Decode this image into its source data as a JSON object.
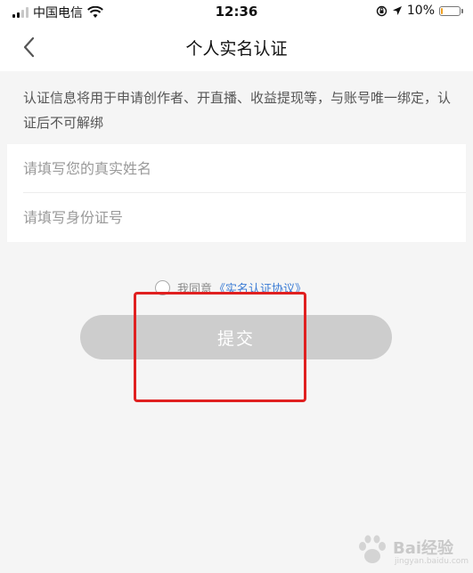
{
  "status_bar": {
    "carrier": "中国电信",
    "time": "12:36",
    "battery_percent": "10%",
    "battery_level": 0.1,
    "battery_color": "#f0a020"
  },
  "nav": {
    "title": "个人实名认证",
    "back_icon": "chevron-left-icon"
  },
  "notice": {
    "text": "认证信息将用于申请创作者、开直播、收益提现等，与账号唯一绑定，认证后不可解绑"
  },
  "form": {
    "name_placeholder": "请填写您的真实姓名",
    "name_value": "",
    "id_placeholder": "请填写身份证号",
    "id_value": ""
  },
  "agreement": {
    "label": "我同意",
    "link": "《实名认证协议》",
    "checked": false
  },
  "submit": {
    "label": "提交",
    "enabled": false,
    "color": "#cdcdcd"
  },
  "annotation": {
    "highlight_color": "#e02020"
  },
  "watermark": {
    "text": "Bai经验",
    "sub": "jingyan.baidu.com"
  }
}
